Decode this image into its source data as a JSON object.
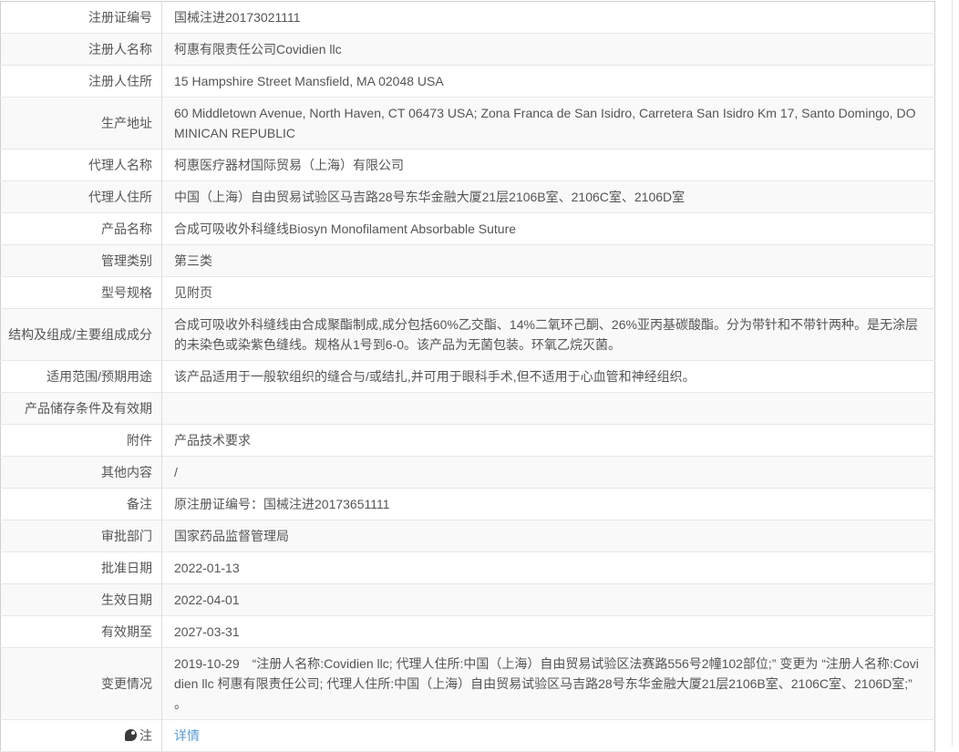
{
  "colors": {
    "text": "#555555",
    "link": "#5b9bd5",
    "row_stripe": "#f9f9f9",
    "row_border": "#e7e7e7",
    "outer_border": "#cfcfcf"
  },
  "table": {
    "rows": [
      {
        "label": "注册证编号",
        "value": "国械注进20173021111"
      },
      {
        "label": "注册人名称",
        "value": "柯惠有限责任公司Covidien llc"
      },
      {
        "label": "注册人住所",
        "value": "15 Hampshire Street Mansfield, MA 02048 USA"
      },
      {
        "label": "生产地址",
        "value": "60 Middletown Avenue, North Haven, CT 06473 USA; Zona Franca de San Isidro, Carretera San Isidro Km 17, Santo Domingo, DOMINICAN REPUBLIC"
      },
      {
        "label": "代理人名称",
        "value": "柯惠医疗器材国际贸易（上海）有限公司"
      },
      {
        "label": "代理人住所",
        "value": "中国（上海）自由贸易试验区马吉路28号东华金融大厦21层2106B室、2106C室、2106D室"
      },
      {
        "label": "产品名称",
        "value": "合成可吸收外科缝线Biosyn Monofilament Absorbable Suture"
      },
      {
        "label": "管理类别",
        "value": "第三类"
      },
      {
        "label": "型号规格",
        "value": "见附页"
      },
      {
        "label": "结构及组成/主要组成成分",
        "value": "合成可吸收外科缝线由合成聚酯制成,成分包括60%乙交酯、14%二氧环己酮、26%亚丙基碳酸酯。分为带针和不带针两种。是无涂层的未染色或染紫色缝线。规格从1号到6-0。该产品为无菌包装。环氧乙烷灭菌。"
      },
      {
        "label": "适用范围/预期用途",
        "value": "该产品适用于一般软组织的缝合与/或结扎,并可用于眼科手术,但不适用于心血管和神经组织。"
      },
      {
        "label": "产品储存条件及有效期",
        "value": ""
      },
      {
        "label": "附件",
        "value": "产品技术要求"
      },
      {
        "label": "其他内容",
        "value": "/"
      },
      {
        "label": "备注",
        "value": "原注册证编号：国械注进20173651111"
      },
      {
        "label": "审批部门",
        "value": "国家药品监督管理局"
      },
      {
        "label": "批准日期",
        "value": "2022-01-13"
      },
      {
        "label": "生效日期",
        "value": "2022-04-01"
      },
      {
        "label": "有效期至",
        "value": "2027-03-31"
      },
      {
        "label": "变更情况",
        "value": "2019-10-29　“注册人名称:Covidien llc; 代理人住所:中国（上海）自由贸易试验区法赛路556号2幢102部位;” 变更为 “注册人名称:Covidien llc 柯惠有限责任公司; 代理人住所:中国（上海）自由贸易试验区马吉路28号东华金融大厦21层2106B室、2106C室、2106D室;” 。"
      },
      {
        "label": "注",
        "value": "详情"
      }
    ]
  }
}
